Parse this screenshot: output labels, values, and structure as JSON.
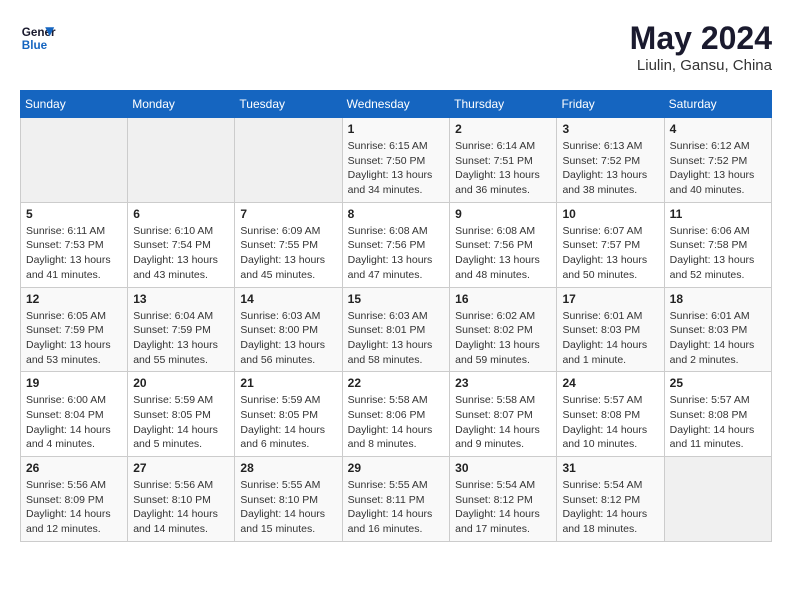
{
  "header": {
    "logo_line1": "General",
    "logo_line2": "Blue",
    "month_year": "May 2024",
    "location": "Liulin, Gansu, China"
  },
  "weekdays": [
    "Sunday",
    "Monday",
    "Tuesday",
    "Wednesday",
    "Thursday",
    "Friday",
    "Saturday"
  ],
  "weeks": [
    [
      {
        "day": "",
        "info": ""
      },
      {
        "day": "",
        "info": ""
      },
      {
        "day": "",
        "info": ""
      },
      {
        "day": "1",
        "info": "Sunrise: 6:15 AM\nSunset: 7:50 PM\nDaylight: 13 hours\nand 34 minutes."
      },
      {
        "day": "2",
        "info": "Sunrise: 6:14 AM\nSunset: 7:51 PM\nDaylight: 13 hours\nand 36 minutes."
      },
      {
        "day": "3",
        "info": "Sunrise: 6:13 AM\nSunset: 7:52 PM\nDaylight: 13 hours\nand 38 minutes."
      },
      {
        "day": "4",
        "info": "Sunrise: 6:12 AM\nSunset: 7:52 PM\nDaylight: 13 hours\nand 40 minutes."
      }
    ],
    [
      {
        "day": "5",
        "info": "Sunrise: 6:11 AM\nSunset: 7:53 PM\nDaylight: 13 hours\nand 41 minutes."
      },
      {
        "day": "6",
        "info": "Sunrise: 6:10 AM\nSunset: 7:54 PM\nDaylight: 13 hours\nand 43 minutes."
      },
      {
        "day": "7",
        "info": "Sunrise: 6:09 AM\nSunset: 7:55 PM\nDaylight: 13 hours\nand 45 minutes."
      },
      {
        "day": "8",
        "info": "Sunrise: 6:08 AM\nSunset: 7:56 PM\nDaylight: 13 hours\nand 47 minutes."
      },
      {
        "day": "9",
        "info": "Sunrise: 6:08 AM\nSunset: 7:56 PM\nDaylight: 13 hours\nand 48 minutes."
      },
      {
        "day": "10",
        "info": "Sunrise: 6:07 AM\nSunset: 7:57 PM\nDaylight: 13 hours\nand 50 minutes."
      },
      {
        "day": "11",
        "info": "Sunrise: 6:06 AM\nSunset: 7:58 PM\nDaylight: 13 hours\nand 52 minutes."
      }
    ],
    [
      {
        "day": "12",
        "info": "Sunrise: 6:05 AM\nSunset: 7:59 PM\nDaylight: 13 hours\nand 53 minutes."
      },
      {
        "day": "13",
        "info": "Sunrise: 6:04 AM\nSunset: 7:59 PM\nDaylight: 13 hours\nand 55 minutes."
      },
      {
        "day": "14",
        "info": "Sunrise: 6:03 AM\nSunset: 8:00 PM\nDaylight: 13 hours\nand 56 minutes."
      },
      {
        "day": "15",
        "info": "Sunrise: 6:03 AM\nSunset: 8:01 PM\nDaylight: 13 hours\nand 58 minutes."
      },
      {
        "day": "16",
        "info": "Sunrise: 6:02 AM\nSunset: 8:02 PM\nDaylight: 13 hours\nand 59 minutes."
      },
      {
        "day": "17",
        "info": "Sunrise: 6:01 AM\nSunset: 8:03 PM\nDaylight: 14 hours\nand 1 minute."
      },
      {
        "day": "18",
        "info": "Sunrise: 6:01 AM\nSunset: 8:03 PM\nDaylight: 14 hours\nand 2 minutes."
      }
    ],
    [
      {
        "day": "19",
        "info": "Sunrise: 6:00 AM\nSunset: 8:04 PM\nDaylight: 14 hours\nand 4 minutes."
      },
      {
        "day": "20",
        "info": "Sunrise: 5:59 AM\nSunset: 8:05 PM\nDaylight: 14 hours\nand 5 minutes."
      },
      {
        "day": "21",
        "info": "Sunrise: 5:59 AM\nSunset: 8:05 PM\nDaylight: 14 hours\nand 6 minutes."
      },
      {
        "day": "22",
        "info": "Sunrise: 5:58 AM\nSunset: 8:06 PM\nDaylight: 14 hours\nand 8 minutes."
      },
      {
        "day": "23",
        "info": "Sunrise: 5:58 AM\nSunset: 8:07 PM\nDaylight: 14 hours\nand 9 minutes."
      },
      {
        "day": "24",
        "info": "Sunrise: 5:57 AM\nSunset: 8:08 PM\nDaylight: 14 hours\nand 10 minutes."
      },
      {
        "day": "25",
        "info": "Sunrise: 5:57 AM\nSunset: 8:08 PM\nDaylight: 14 hours\nand 11 minutes."
      }
    ],
    [
      {
        "day": "26",
        "info": "Sunrise: 5:56 AM\nSunset: 8:09 PM\nDaylight: 14 hours\nand 12 minutes."
      },
      {
        "day": "27",
        "info": "Sunrise: 5:56 AM\nSunset: 8:10 PM\nDaylight: 14 hours\nand 14 minutes."
      },
      {
        "day": "28",
        "info": "Sunrise: 5:55 AM\nSunset: 8:10 PM\nDaylight: 14 hours\nand 15 minutes."
      },
      {
        "day": "29",
        "info": "Sunrise: 5:55 AM\nSunset: 8:11 PM\nDaylight: 14 hours\nand 16 minutes."
      },
      {
        "day": "30",
        "info": "Sunrise: 5:54 AM\nSunset: 8:12 PM\nDaylight: 14 hours\nand 17 minutes."
      },
      {
        "day": "31",
        "info": "Sunrise: 5:54 AM\nSunset: 8:12 PM\nDaylight: 14 hours\nand 18 minutes."
      },
      {
        "day": "",
        "info": ""
      }
    ]
  ]
}
